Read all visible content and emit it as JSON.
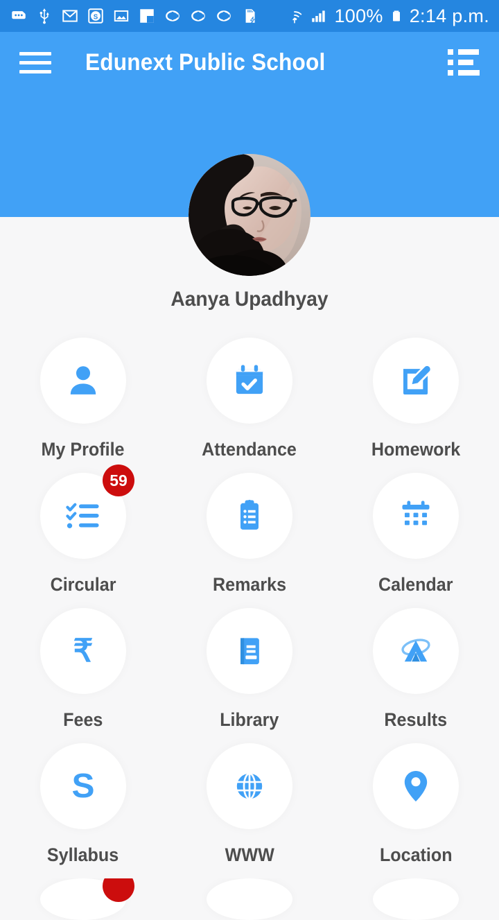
{
  "status_bar": {
    "icons": [
      {
        "name": "sim-card-icon",
        "glyph": "sim"
      },
      {
        "name": "usb-icon",
        "glyph": "usb"
      },
      {
        "name": "gmail-icon",
        "glyph": "gmail"
      },
      {
        "name": "skype-icon",
        "glyph": "skype"
      },
      {
        "name": "gallery-icon",
        "glyph": "image"
      },
      {
        "name": "flipboard-icon",
        "glyph": "flag"
      },
      {
        "name": "opera-icon-1",
        "glyph": "opera"
      },
      {
        "name": "opera-icon-2",
        "glyph": "opera"
      },
      {
        "name": "opera-icon-3",
        "glyph": "opera"
      },
      {
        "name": "sd-card-icon",
        "glyph": "sdcard"
      }
    ],
    "wifi_icon": "wifi-icon",
    "signal_icon": "signal-icon",
    "battery_percent": "100%",
    "battery_icon": "battery-full-icon",
    "time": "2:14 p.m."
  },
  "header": {
    "menu_icon": "hamburger-menu-icon",
    "title": "Edunext Public School",
    "list_icon": "list-view-icon",
    "background_color": "#41a1f6"
  },
  "profile": {
    "avatar_name": "student-avatar",
    "name": "Aanya Upadhyay"
  },
  "colors": {
    "accent": "#41a1f6",
    "status_bar": "#2586e0",
    "badge_red": "#cc0d0d",
    "label_text": "#4d4d4d",
    "page_background": "#f7f7f8",
    "tile_background": "#ffffff"
  },
  "menu": {
    "tiles": [
      {
        "label": "My Profile",
        "icon": "person-icon",
        "badge": null
      },
      {
        "label": "Attendance",
        "icon": "calendar-check-icon",
        "badge": null
      },
      {
        "label": "Homework",
        "icon": "edit-square-icon",
        "badge": null
      },
      {
        "label": "Circular",
        "icon": "checklist-icon",
        "badge": "59"
      },
      {
        "label": "Remarks",
        "icon": "clipboard-icon",
        "badge": null
      },
      {
        "label": "Calendar",
        "icon": "calendar-grid-icon",
        "badge": null
      },
      {
        "label": "Fees",
        "icon": "rupee-icon",
        "badge": null
      },
      {
        "label": "Library",
        "icon": "book-icon",
        "badge": null
      },
      {
        "label": "Results",
        "icon": "results-logo-icon",
        "badge": null
      },
      {
        "label": "Syllabus",
        "icon": "letter-s-icon",
        "badge": null
      },
      {
        "label": "WWW",
        "icon": "globe-icon",
        "badge": null
      },
      {
        "label": "Location",
        "icon": "map-pin-icon",
        "badge": null
      }
    ],
    "partial_row": [
      {
        "label": "",
        "icon": "tile-icon-partial",
        "badge": ""
      },
      {
        "label": "",
        "icon": "tile-icon-partial",
        "badge": null
      },
      {
        "label": "",
        "icon": "tile-icon-partial",
        "badge": null
      }
    ]
  }
}
